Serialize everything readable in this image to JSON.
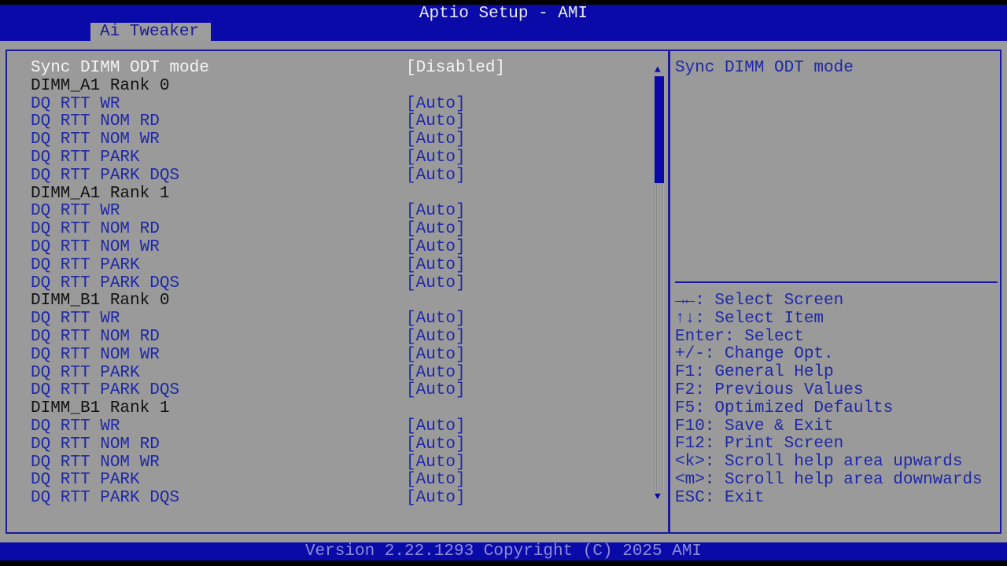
{
  "window": {
    "title": "Aptio Setup - AMI",
    "tab": "Ai Tweaker"
  },
  "items": [
    {
      "label": "Sync DIMM ODT mode",
      "value": "[Disabled]",
      "kind": "selected"
    },
    {
      "label": "DIMM_A1 Rank 0",
      "value": "",
      "kind": "heading"
    },
    {
      "label": "DQ RTT WR",
      "value": "[Auto]",
      "kind": "option"
    },
    {
      "label": "DQ RTT NOM RD",
      "value": "[Auto]",
      "kind": "option"
    },
    {
      "label": "DQ RTT NOM WR",
      "value": "[Auto]",
      "kind": "option"
    },
    {
      "label": "DQ RTT PARK",
      "value": "[Auto]",
      "kind": "option"
    },
    {
      "label": "DQ RTT PARK DQS",
      "value": "[Auto]",
      "kind": "option"
    },
    {
      "label": "DIMM_A1 Rank 1",
      "value": "",
      "kind": "heading"
    },
    {
      "label": "DQ RTT WR",
      "value": "[Auto]",
      "kind": "option"
    },
    {
      "label": "DQ RTT NOM RD",
      "value": "[Auto]",
      "kind": "option"
    },
    {
      "label": "DQ RTT NOM WR",
      "value": "[Auto]",
      "kind": "option"
    },
    {
      "label": "DQ RTT PARK",
      "value": "[Auto]",
      "kind": "option"
    },
    {
      "label": "DQ RTT PARK DQS",
      "value": "[Auto]",
      "kind": "option"
    },
    {
      "label": "DIMM_B1 Rank 0",
      "value": "",
      "kind": "heading"
    },
    {
      "label": "DQ RTT WR",
      "value": "[Auto]",
      "kind": "option"
    },
    {
      "label": "DQ RTT NOM RD",
      "value": "[Auto]",
      "kind": "option"
    },
    {
      "label": "DQ RTT NOM WR",
      "value": "[Auto]",
      "kind": "option"
    },
    {
      "label": "DQ RTT PARK",
      "value": "[Auto]",
      "kind": "option"
    },
    {
      "label": "DQ RTT PARK DQS",
      "value": "[Auto]",
      "kind": "option"
    },
    {
      "label": "DIMM_B1 Rank 1",
      "value": "",
      "kind": "heading"
    },
    {
      "label": "DQ RTT WR",
      "value": "[Auto]",
      "kind": "option"
    },
    {
      "label": "DQ RTT NOM RD",
      "value": "[Auto]",
      "kind": "option"
    },
    {
      "label": "DQ RTT NOM WR",
      "value": "[Auto]",
      "kind": "option"
    },
    {
      "label": "DQ RTT PARK",
      "value": "[Auto]",
      "kind": "option"
    },
    {
      "label": "DQ RTT PARK DQS",
      "value": "[Auto]",
      "kind": "option"
    }
  ],
  "help": {
    "description": "Sync DIMM ODT mode",
    "keys": [
      "→←: Select Screen",
      "↑↓: Select Item",
      "Enter: Select",
      "+/-: Change Opt.",
      "F1: General Help",
      "F2: Previous Values",
      "F5: Optimized Defaults",
      "F10: Save & Exit",
      "F12: Print Screen",
      "<k>: Scroll help area upwards",
      "<m>: Scroll help area downwards",
      "ESC: Exit"
    ]
  },
  "scrollbar": {
    "position_fraction": 0.0,
    "visible_fraction": 0.26
  },
  "footer": "Version 2.22.1293 Copyright (C) 2025 AMI"
}
